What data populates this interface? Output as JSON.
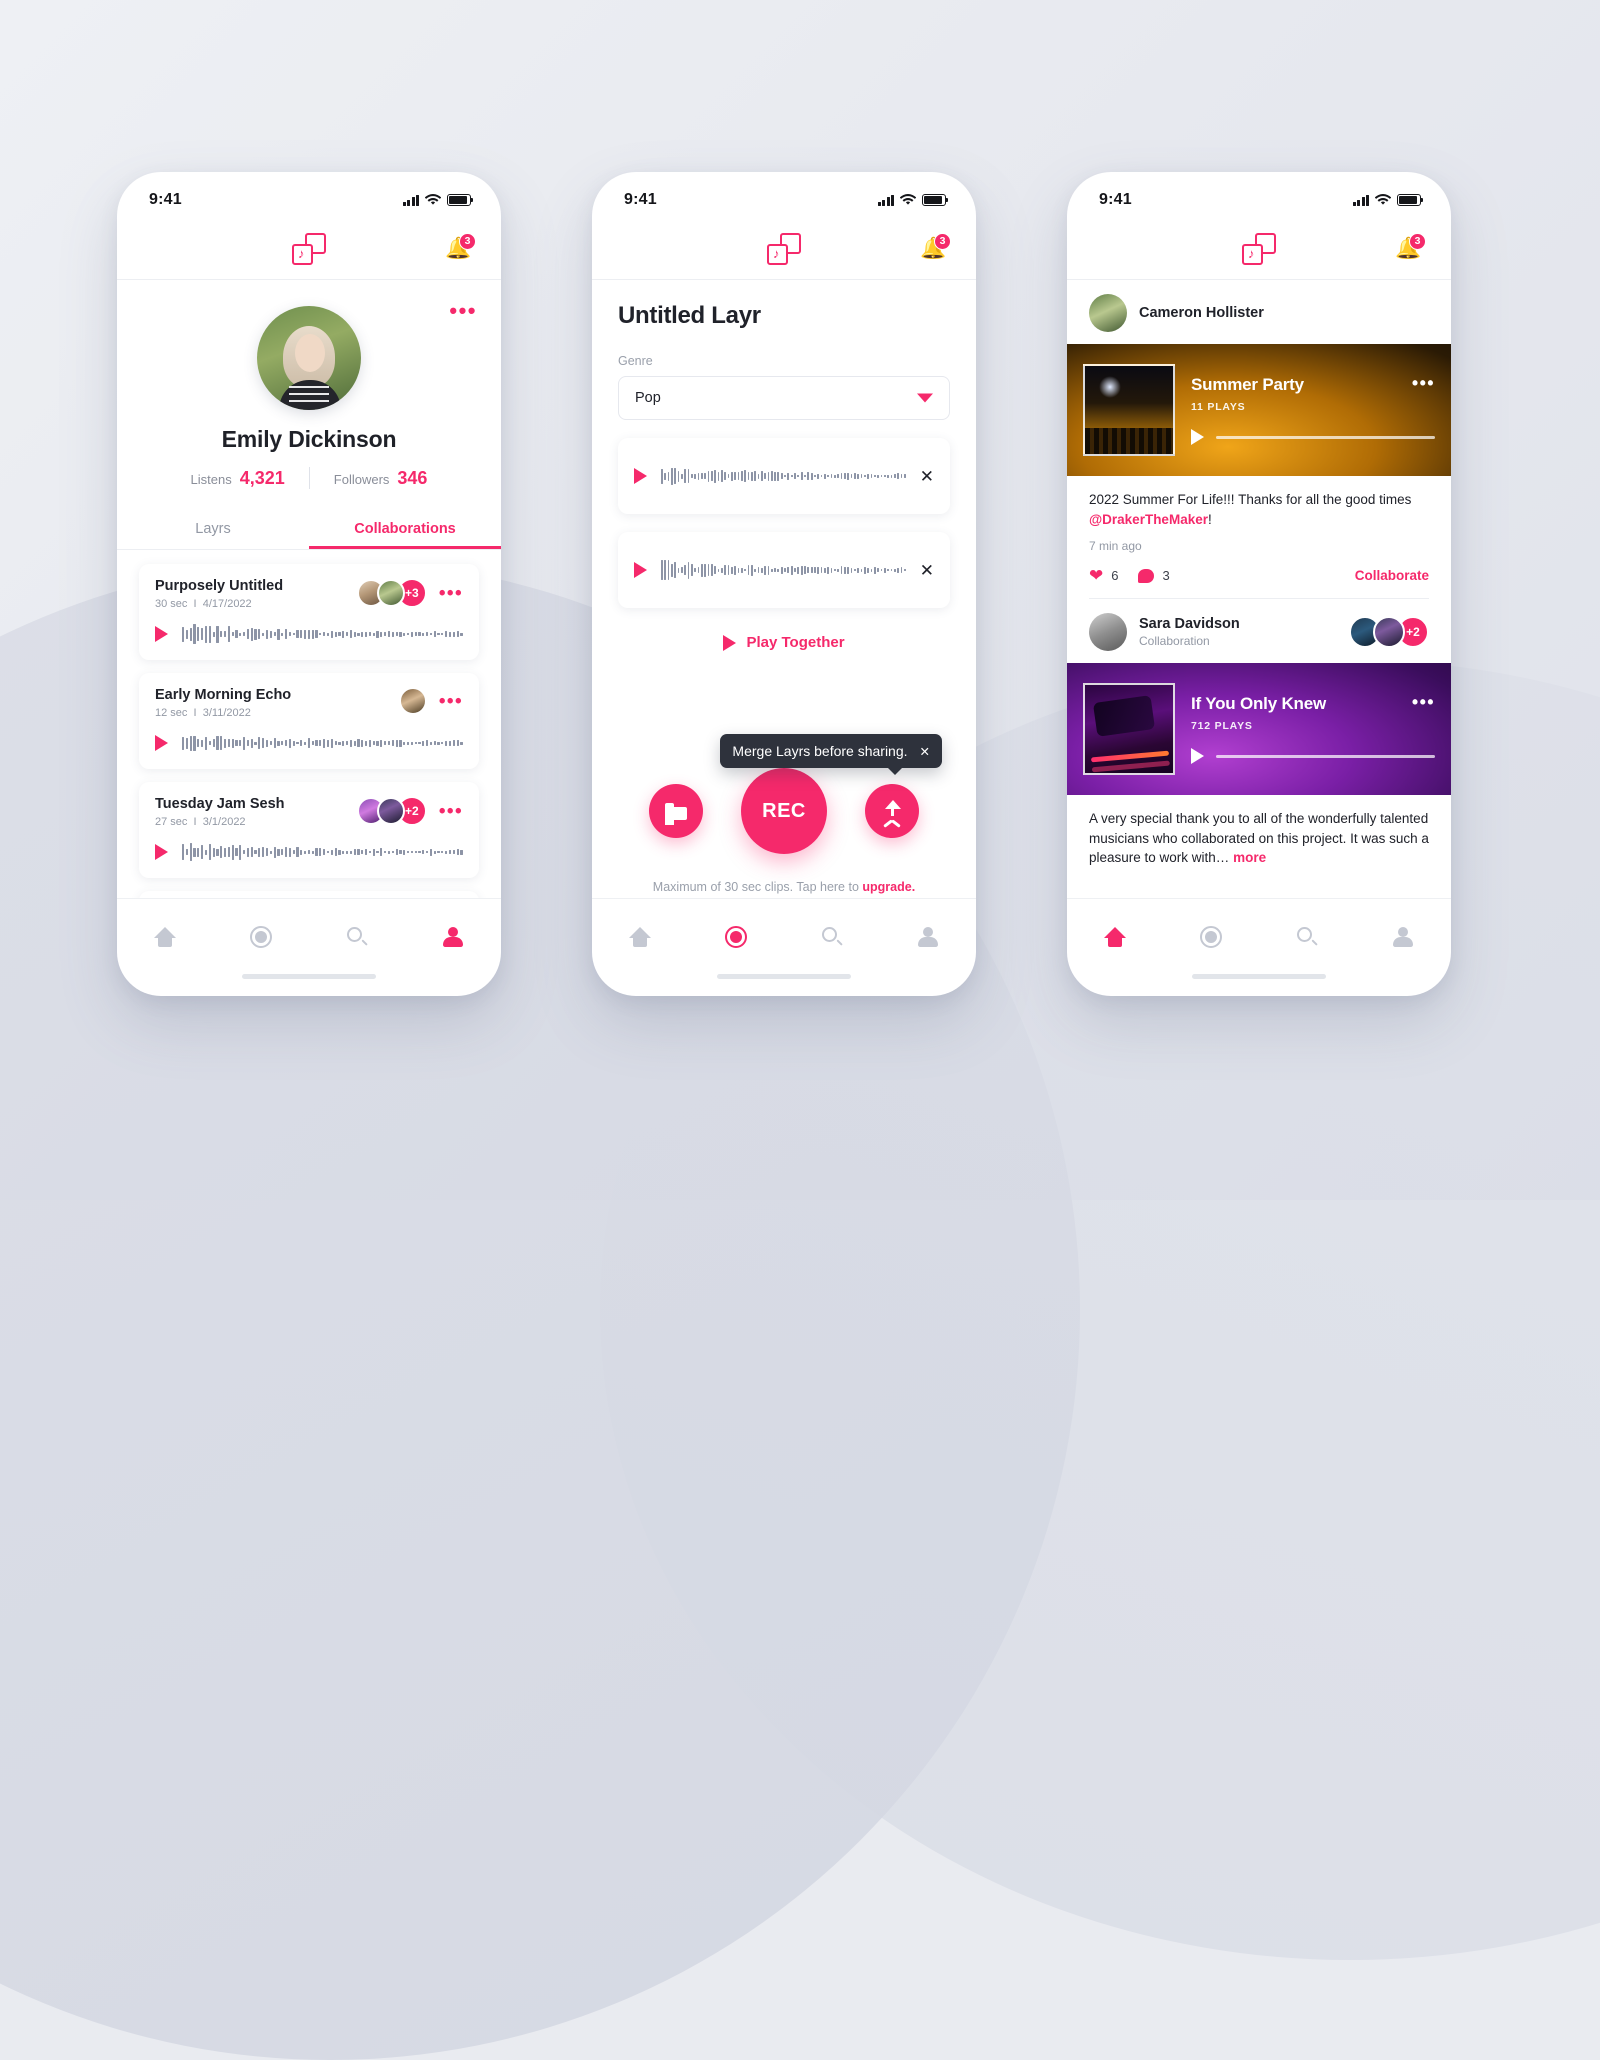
{
  "statusbar": {
    "time": "9:41"
  },
  "appbar": {
    "logo_icon": "layers-music-note-icon",
    "bell_icon": "bell-icon",
    "badge": "3"
  },
  "screen1": {
    "menu_dots": "•••",
    "avatar": "profile-avatar",
    "name": "Emily Dickinson",
    "stats": [
      {
        "label": "Listens",
        "value": "4,321"
      },
      {
        "label": "Followers",
        "value": "346"
      }
    ],
    "tabs": [
      {
        "label": "Layrs",
        "active": false
      },
      {
        "label": "Collaborations",
        "active": true
      }
    ],
    "tracks": [
      {
        "title": "Purposely Untitled",
        "duration": "30 sec",
        "sep": "I",
        "date": "4/17/2022",
        "extra": "+3",
        "avatars": 2
      },
      {
        "title": "Early Morning Echo",
        "duration": "12 sec",
        "sep": "I",
        "date": "3/11/2022",
        "extra": "",
        "avatars": 1
      },
      {
        "title": "Tuesday Jam Sesh",
        "duration": "27 sec",
        "sep": "I",
        "date": "3/1/2022",
        "extra": "+2",
        "avatars": 2
      }
    ],
    "nav_active": "profile"
  },
  "screen2": {
    "title": "Untitled Layr",
    "genre_label": "Genre",
    "genre_value": "Pop",
    "clips": [
      {
        "id": "clip-1"
      },
      {
        "id": "clip-2"
      }
    ],
    "play_together": "Play Together",
    "rec_label": "REC",
    "folder_icon": "folder-icon",
    "merge_icon": "merge-arrow-icon",
    "tooltip": "Merge Layrs before sharing.",
    "note_plain": "Maximum of 30 sec clips. Tap here to ",
    "note_link": "upgrade.",
    "nav_active": "record"
  },
  "screen3": {
    "posts": [
      {
        "author": "Cameron Hollister",
        "subtitle": "",
        "track_title": "Summer Party",
        "plays": "11 PLAYS",
        "text_before": "2022 Summer For Life!!! Thanks for all the good times ",
        "mention": "@DrakerTheMaker",
        "text_after": "!",
        "time": "7 min ago",
        "likes": "6",
        "comments": "3",
        "collaborate": "Collaborate"
      },
      {
        "author": "Sara Davidson",
        "subtitle": "Collaboration",
        "extra": "+2",
        "track_title": "If You Only Knew",
        "plays": "712 PLAYS",
        "text": "A very special thank you to all of the wonderfully talented musicians who collaborated on this project. It was such a pleasure to work with… ",
        "more": "more"
      }
    ],
    "nav_active": "home"
  },
  "colors": {
    "accent": "#f5296b",
    "dark": "#20222a",
    "muted": "#9298a4",
    "tooltip_bg": "#2e323c"
  }
}
